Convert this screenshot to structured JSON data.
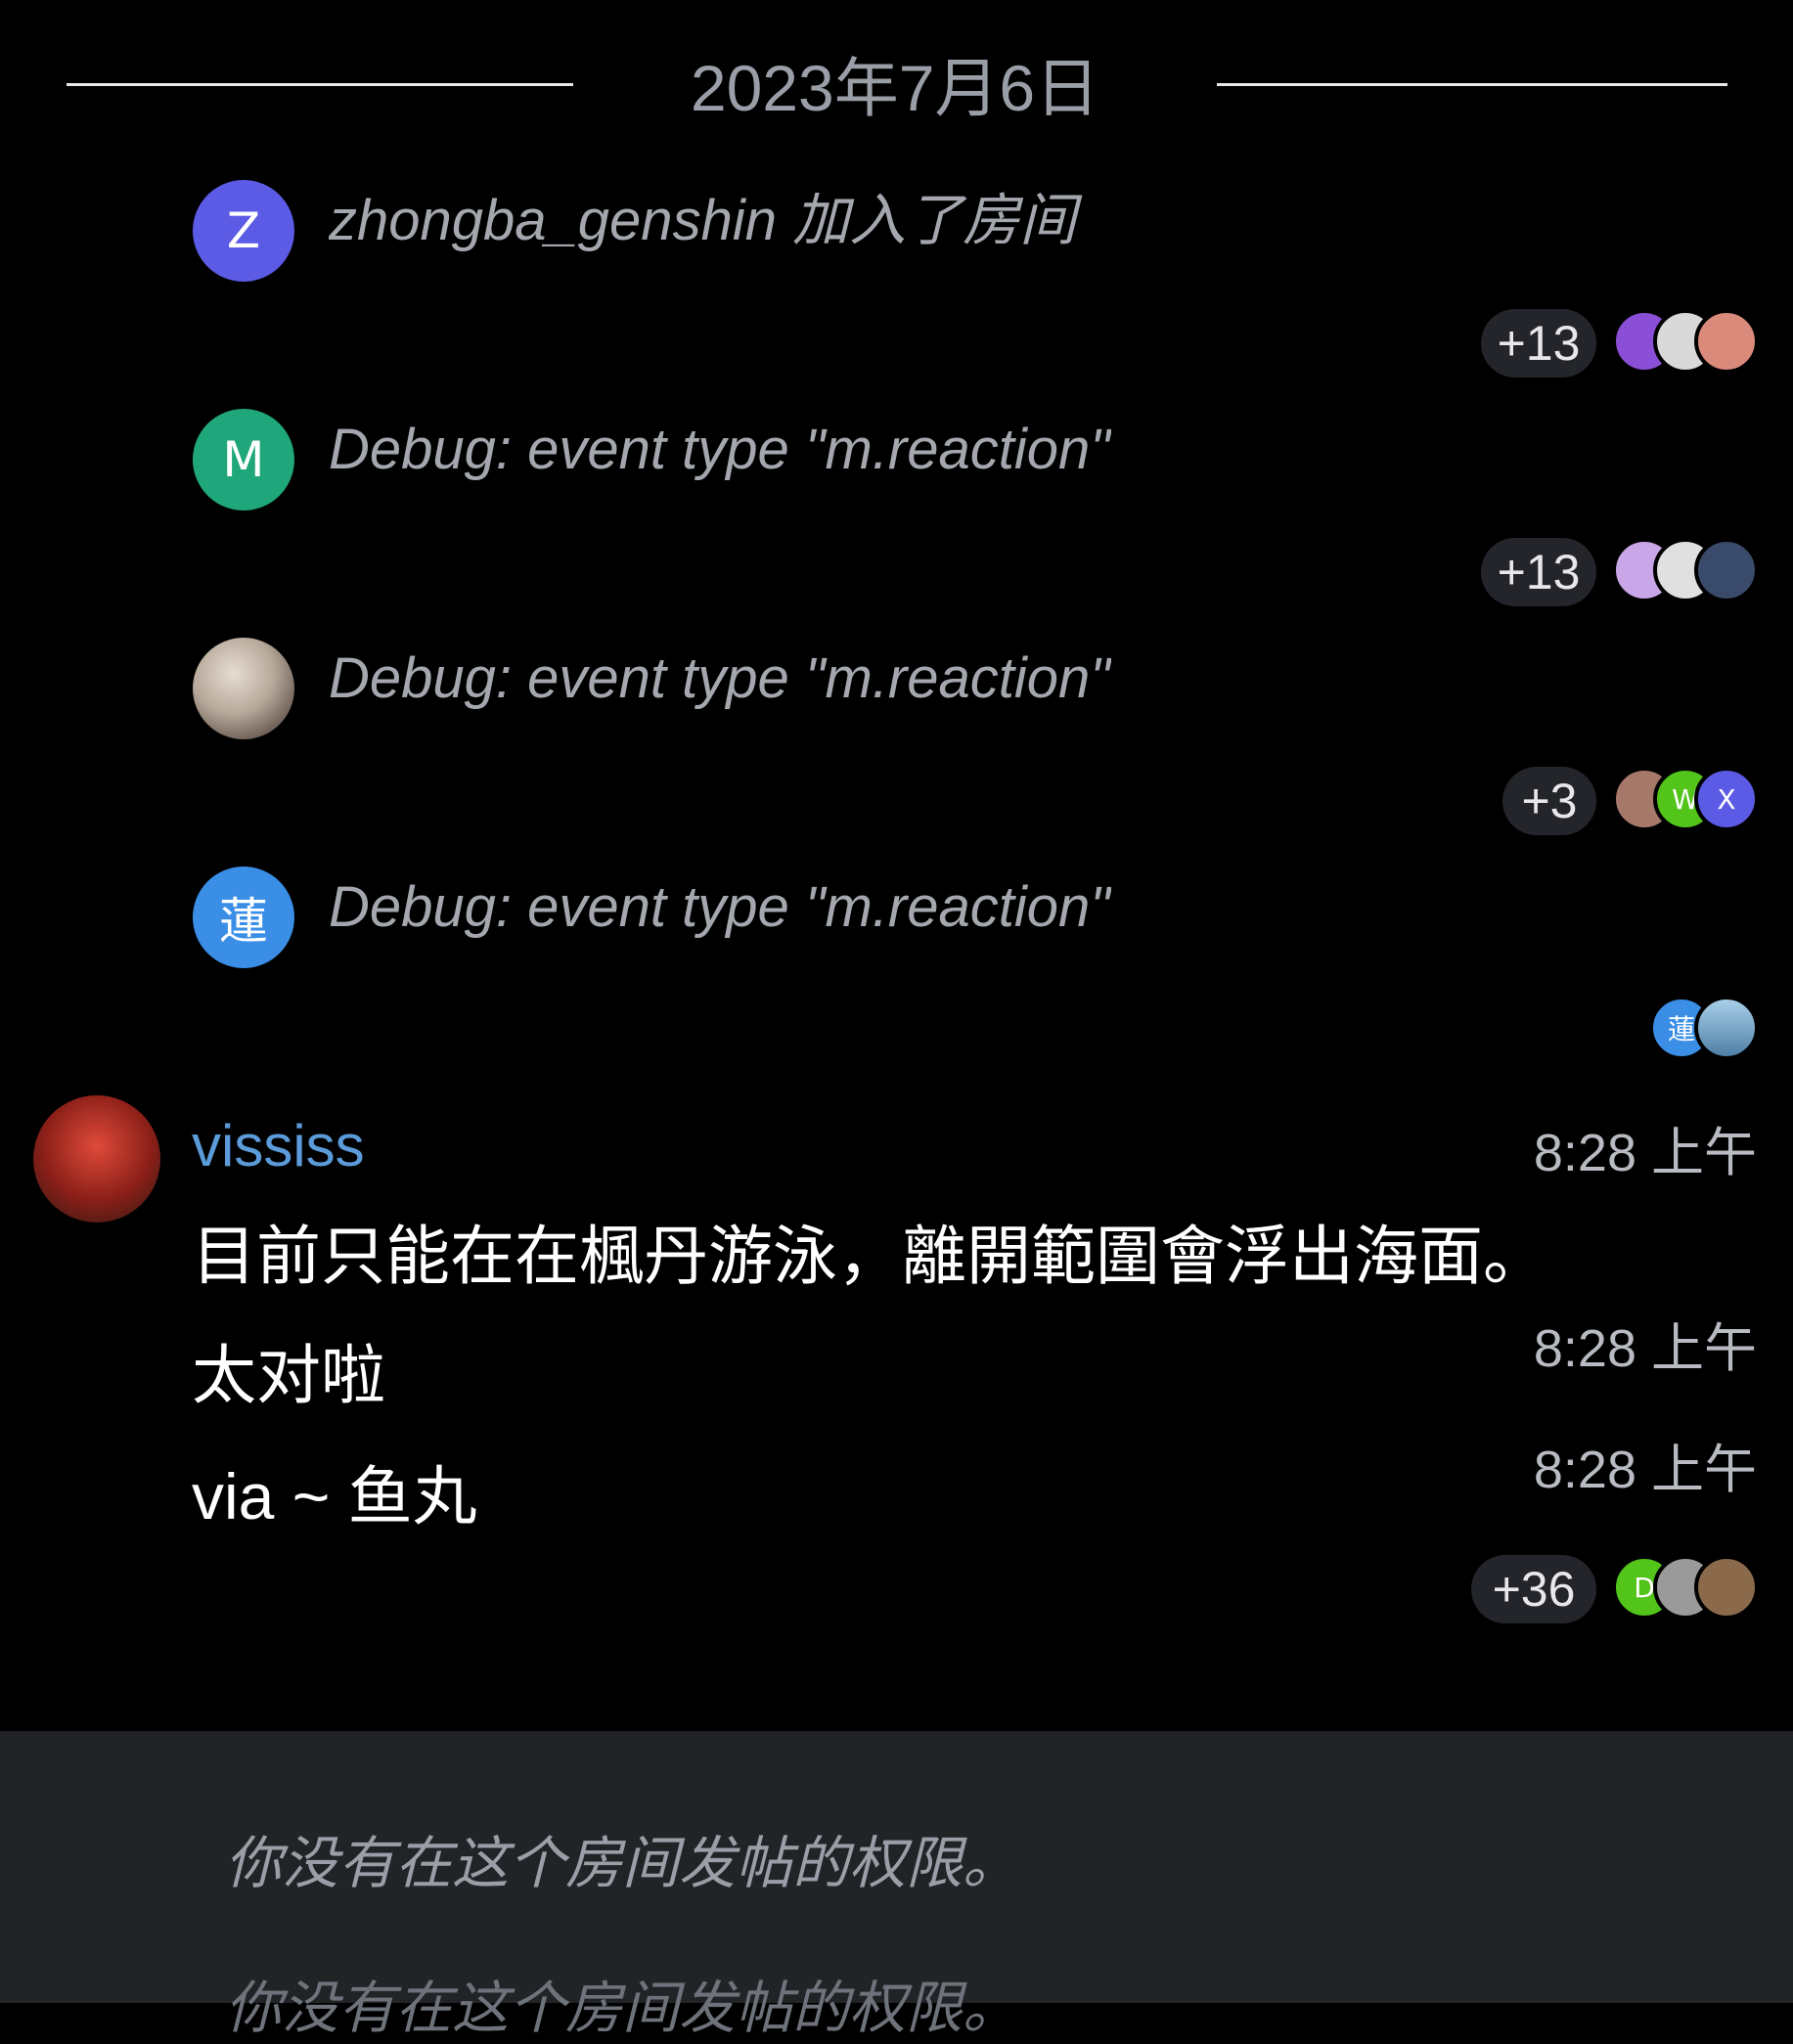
{
  "date_separator": "2023年7月6日",
  "events": [
    {
      "avatar": {
        "letter": "Z",
        "color": "#5b5be6"
      },
      "text": "zhongba_genshin 加入了房间",
      "reactions": {
        "count": "+13",
        "avatars": [
          "#8a4fd6",
          "#d9d9d9",
          "#d98a7a"
        ]
      }
    },
    {
      "avatar": {
        "letter": "M",
        "color": "#1fa67a"
      },
      "text": "Debug:  event type \"m.reaction\"",
      "reactions": {
        "count": "+13",
        "avatars": [
          "#c9a6e8",
          "#e0e0e0",
          "#3a4a6a"
        ]
      }
    },
    {
      "avatar": {
        "letter": "",
        "color": "#a89e94"
      },
      "text": "Debug:  event type \"m.reaction\"",
      "reactions": {
        "count": "+3",
        "avatars": [
          "#a6786a",
          "#52c41a",
          "#5b5be6"
        ],
        "letters": [
          "",
          "W",
          "X"
        ]
      }
    },
    {
      "avatar": {
        "letter": "蓮",
        "color": "#3a8ee6"
      },
      "text": "Debug:  event type \"m.reaction\"",
      "reactions": {
        "count": "",
        "avatars": [
          "#3a8ee6",
          "#7fb0d9"
        ],
        "letters": [
          "蓮",
          ""
        ]
      }
    }
  ],
  "message": {
    "sender": "vississ",
    "avatar_color": "#b8322a",
    "lines": [
      {
        "text": "目前只能在在楓丹游泳，離開範圍會浮出海面。",
        "time": "8:28 上午"
      },
      {
        "text": "太对啦",
        "time": "8:28 上午"
      },
      {
        "text": "via ~ 鱼丸",
        "time": "8:28 上午"
      }
    ],
    "reactions": {
      "count": "+36",
      "avatars": [
        "#52c41a",
        "#9a9a9a",
        "#8a6a4a"
      ],
      "letters": [
        "D",
        "",
        ""
      ]
    }
  },
  "composer": {
    "notice": "你没有在这个房间发帖的权限。",
    "notice_2": "你没有在这个房间发帖的权限。"
  }
}
